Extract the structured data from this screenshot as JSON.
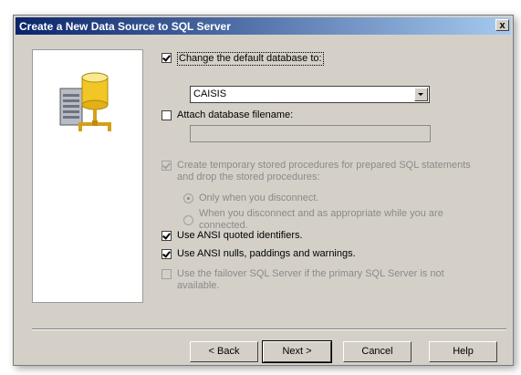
{
  "dialog": {
    "title": "Create a New Data Source to SQL Server",
    "close_label": "x"
  },
  "options": {
    "change_default_db": {
      "label": "Change the default database to:",
      "checked": true
    },
    "database_select": {
      "value": "CAISIS"
    },
    "attach_db": {
      "label": "Attach database filename:",
      "checked": false
    },
    "attach_filename": {
      "value": ""
    },
    "temp_procs": {
      "line1": "Create temporary stored procedures for prepared SQL statements",
      "line2": "and drop the stored procedures:",
      "checked": true,
      "disabled": true
    },
    "radio_only_disconnect": {
      "label": "Only when you disconnect.",
      "checked": true
    },
    "radio_disconnect_appropriate": {
      "line1": "When you disconnect and as appropriate while you are",
      "line2": "connected.",
      "checked": false
    },
    "ansi_quoted": {
      "label": "Use ANSI quoted identifiers.",
      "checked": true
    },
    "ansi_nulls": {
      "label": "Use ANSI nulls, paddings and warnings.",
      "checked": true
    },
    "failover": {
      "line1": "Use the failover SQL Server if the primary SQL Server is not",
      "line2": "available.",
      "checked": false,
      "disabled": true
    }
  },
  "buttons": {
    "back": "< Back",
    "next": "Next >",
    "cancel": "Cancel",
    "help": "Help"
  },
  "colors": {
    "title_gradient_start": "#0a246a",
    "title_gradient_end": "#a6caf0",
    "dialog_bg": "#d4d0c8"
  },
  "icons": {
    "panel_icon": "database-server-icon"
  }
}
